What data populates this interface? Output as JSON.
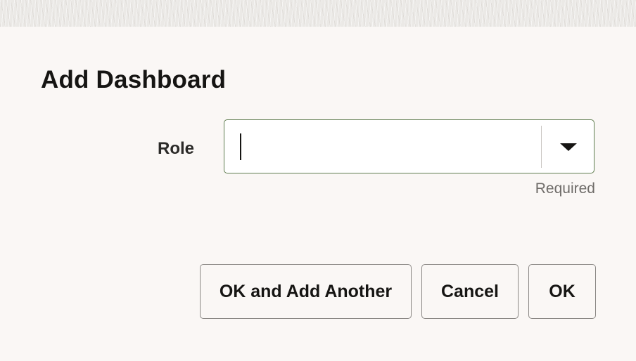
{
  "dialog": {
    "title": "Add Dashboard",
    "role": {
      "label": "Role",
      "value": "",
      "placeholder": "",
      "hint": "Required",
      "dropdown_icon": "triangle-down-icon"
    },
    "buttons": {
      "ok_and_add_another": "OK and Add Another",
      "cancel": "Cancel",
      "ok": "OK"
    }
  },
  "colors": {
    "background": "#faf7f5",
    "field_border": "#5f7d4f",
    "text": "#161513",
    "hint_text": "#6f6c69",
    "button_border": "#8a8784"
  }
}
